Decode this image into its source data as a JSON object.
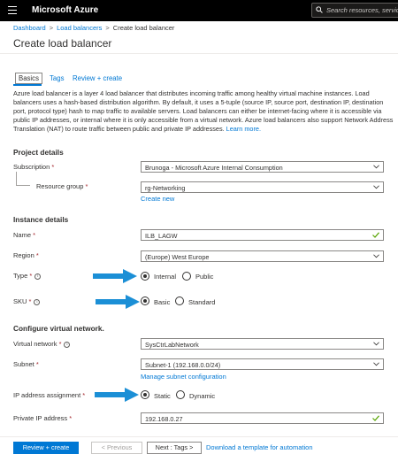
{
  "topbar": {
    "brand": "Microsoft Azure",
    "search_placeholder": "Search resources, services"
  },
  "breadcrumb": [
    "Dashboard",
    "Load balancers",
    "Create load balancer"
  ],
  "page_title": "Create load balancer",
  "tabs": [
    {
      "label": "Basics",
      "active": true
    },
    {
      "label": "Tags",
      "active": false
    },
    {
      "label": "Review + create",
      "active": false
    }
  ],
  "description": "Azure load balancer is a layer 4 load balancer that distributes incoming traffic among healthy virtual machine instances. Load balancers uses a hash-based distribution algorithm. By default, it uses a 5-tuple (source IP, source port, destination IP, destination port, protocol type) hash to map traffic to available servers. Load balancers can either be internet-facing where it is accessible via public IP addresses, or internal where it is only accessible from a virtual network. Azure load balancers also support Network Address Translation (NAT) to route traffic between public and private IP addresses.",
  "learn_more": "Learn more.",
  "project": {
    "heading": "Project details",
    "subscription_label": "Subscription",
    "subscription_value": "Brunoga - Microsoft Azure Internal Consumption",
    "resource_group_label": "Resource group",
    "resource_group_value": "rg-Networking",
    "create_new": "Create new"
  },
  "instance": {
    "heading": "Instance details",
    "name_label": "Name",
    "name_value": "ILB_LAGW",
    "region_label": "Region",
    "region_value": "(Europe) West Europe",
    "type_label": "Type",
    "type_options": [
      "Internal",
      "Public"
    ],
    "type_selected": "Internal",
    "sku_label": "SKU",
    "sku_options": [
      "Basic",
      "Standard"
    ],
    "sku_selected": "Basic"
  },
  "vnet": {
    "heading": "Configure virtual network.",
    "vnet_label": "Virtual network",
    "vnet_value": "SysCtrLabNetwork",
    "subnet_label": "Subnet",
    "subnet_value": "Subnet-1 (192.168.0.0/24)",
    "manage_subnet": "Manage subnet configuration",
    "ip_assign_label": "IP address assignment",
    "ip_assign_options": [
      "Static",
      "Dynamic"
    ],
    "ip_assign_selected": "Static",
    "private_ip_label": "Private IP address",
    "private_ip_value": "192.168.0.27"
  },
  "footer": {
    "review_create": "Review + create",
    "previous": "< Previous",
    "next": "Next : Tags >",
    "download_template": "Download a template for automation"
  },
  "colors": {
    "accent": "#0078d4",
    "required": "#a4262c",
    "valid_check": "#57a300",
    "arrow": "#1b8fd6"
  }
}
